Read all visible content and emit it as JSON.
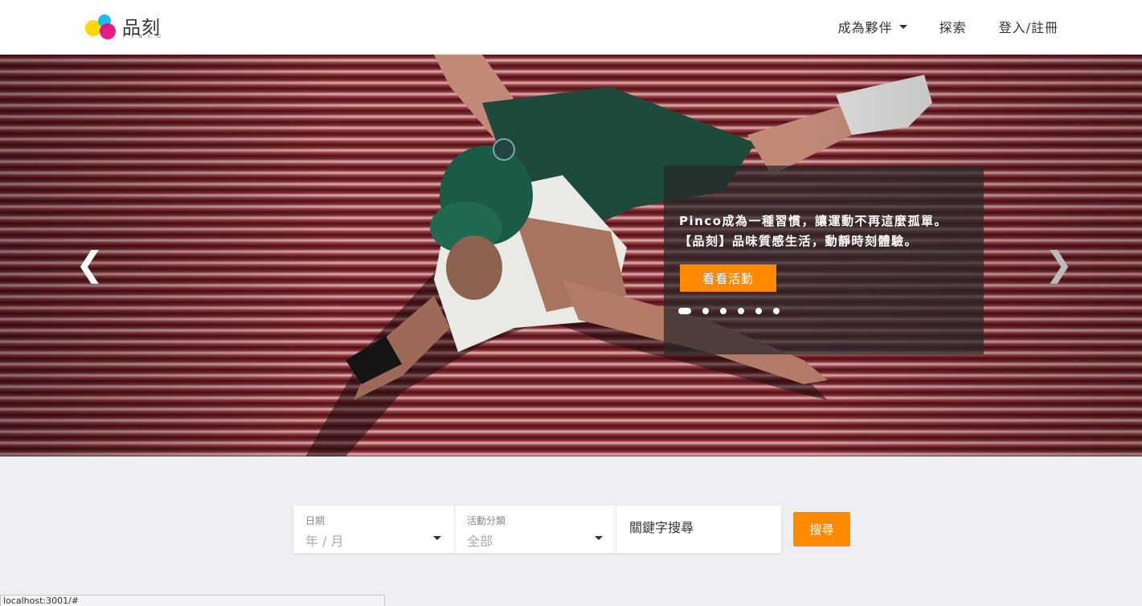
{
  "brand": {
    "name": "品刻",
    "sub": "PINCO",
    "colors": {
      "yellow": "#ffd800",
      "magenta": "#e6007e",
      "cyan": "#00b7ee"
    }
  },
  "nav": {
    "partner_label": "成為夥伴",
    "explore_label": "探索",
    "login_label": "登入/註冊"
  },
  "hero": {
    "caption_line1": "Pinco成為一種習慣，讓運動不再這麼孤單。",
    "caption_line2": "【品刻】品味質感生活，動靜時刻體驗。",
    "cta_label": "看看活動",
    "slide_count": 6,
    "active_slide": 1,
    "accent": "#ff8a00"
  },
  "search": {
    "date_label": "日期",
    "date_value": "年 / 月",
    "category_label": "活動分類",
    "category_value": "全部",
    "keyword_placeholder": "關鍵字搜尋",
    "button_label": "搜尋"
  },
  "status": {
    "url": "localhost:3001/#"
  }
}
